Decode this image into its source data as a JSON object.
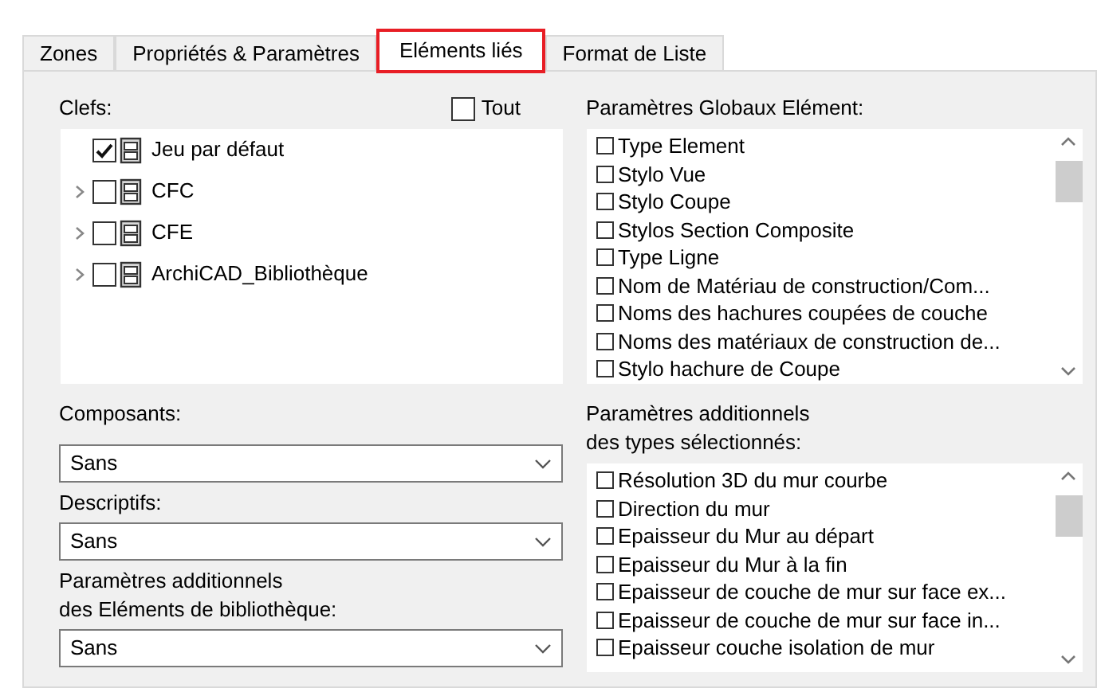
{
  "tabs": [
    {
      "label": "Zones",
      "selected": false
    },
    {
      "label": "Propriétés & Paramètres",
      "selected": false
    },
    {
      "label": "Eléments liés",
      "selected": true
    },
    {
      "label": "Format de Liste",
      "selected": false
    }
  ],
  "keys": {
    "label": "Clefs:",
    "all_checkbox": {
      "label": "Tout",
      "checked": false
    },
    "items": [
      {
        "label": "Jeu par défaut",
        "checked": true,
        "expandable": false
      },
      {
        "label": "CFC",
        "checked": false,
        "expandable": true
      },
      {
        "label": "CFE",
        "checked": false,
        "expandable": true
      },
      {
        "label": "ArchiCAD_Bibliothèque",
        "checked": false,
        "expandable": true
      }
    ]
  },
  "dropdowns": [
    {
      "label": "Composants:",
      "value": "Sans"
    },
    {
      "label": "Descriptifs:",
      "value": "Sans"
    },
    {
      "label": "Paramètres additionnels\ndes Eléments de bibliothèque:",
      "value": "Sans"
    }
  ],
  "global_params": {
    "label": "Paramètres Globaux Elément:",
    "items": [
      {
        "label": "Type Element",
        "checked": false
      },
      {
        "label": "Stylo Vue",
        "checked": false
      },
      {
        "label": "Stylo Coupe",
        "checked": false
      },
      {
        "label": "Stylos Section Composite",
        "checked": false
      },
      {
        "label": "Type Ligne",
        "checked": false
      },
      {
        "label": "Nom de Matériau de construction/Com...",
        "checked": false
      },
      {
        "label": "Noms des hachures coupées de couche",
        "checked": false
      },
      {
        "label": "Noms des matériaux de construction de...",
        "checked": false
      },
      {
        "label": "Stylo hachure de Coupe",
        "checked": false
      }
    ]
  },
  "type_params": {
    "label": "Paramètres additionnels\ndes types sélectionnés:",
    "items": [
      {
        "label": "Résolution 3D du mur courbe",
        "checked": false
      },
      {
        "label": "Direction du mur",
        "checked": false
      },
      {
        "label": "Epaisseur du Mur au départ",
        "checked": false
      },
      {
        "label": "Epaisseur du Mur à la fin",
        "checked": false
      },
      {
        "label": "Epaisseur de couche de mur sur face ex...",
        "checked": false
      },
      {
        "label": "Epaisseur de couche de mur sur face in...",
        "checked": false
      },
      {
        "label": "Epaisseur couche isolation de mur",
        "checked": false
      }
    ]
  }
}
